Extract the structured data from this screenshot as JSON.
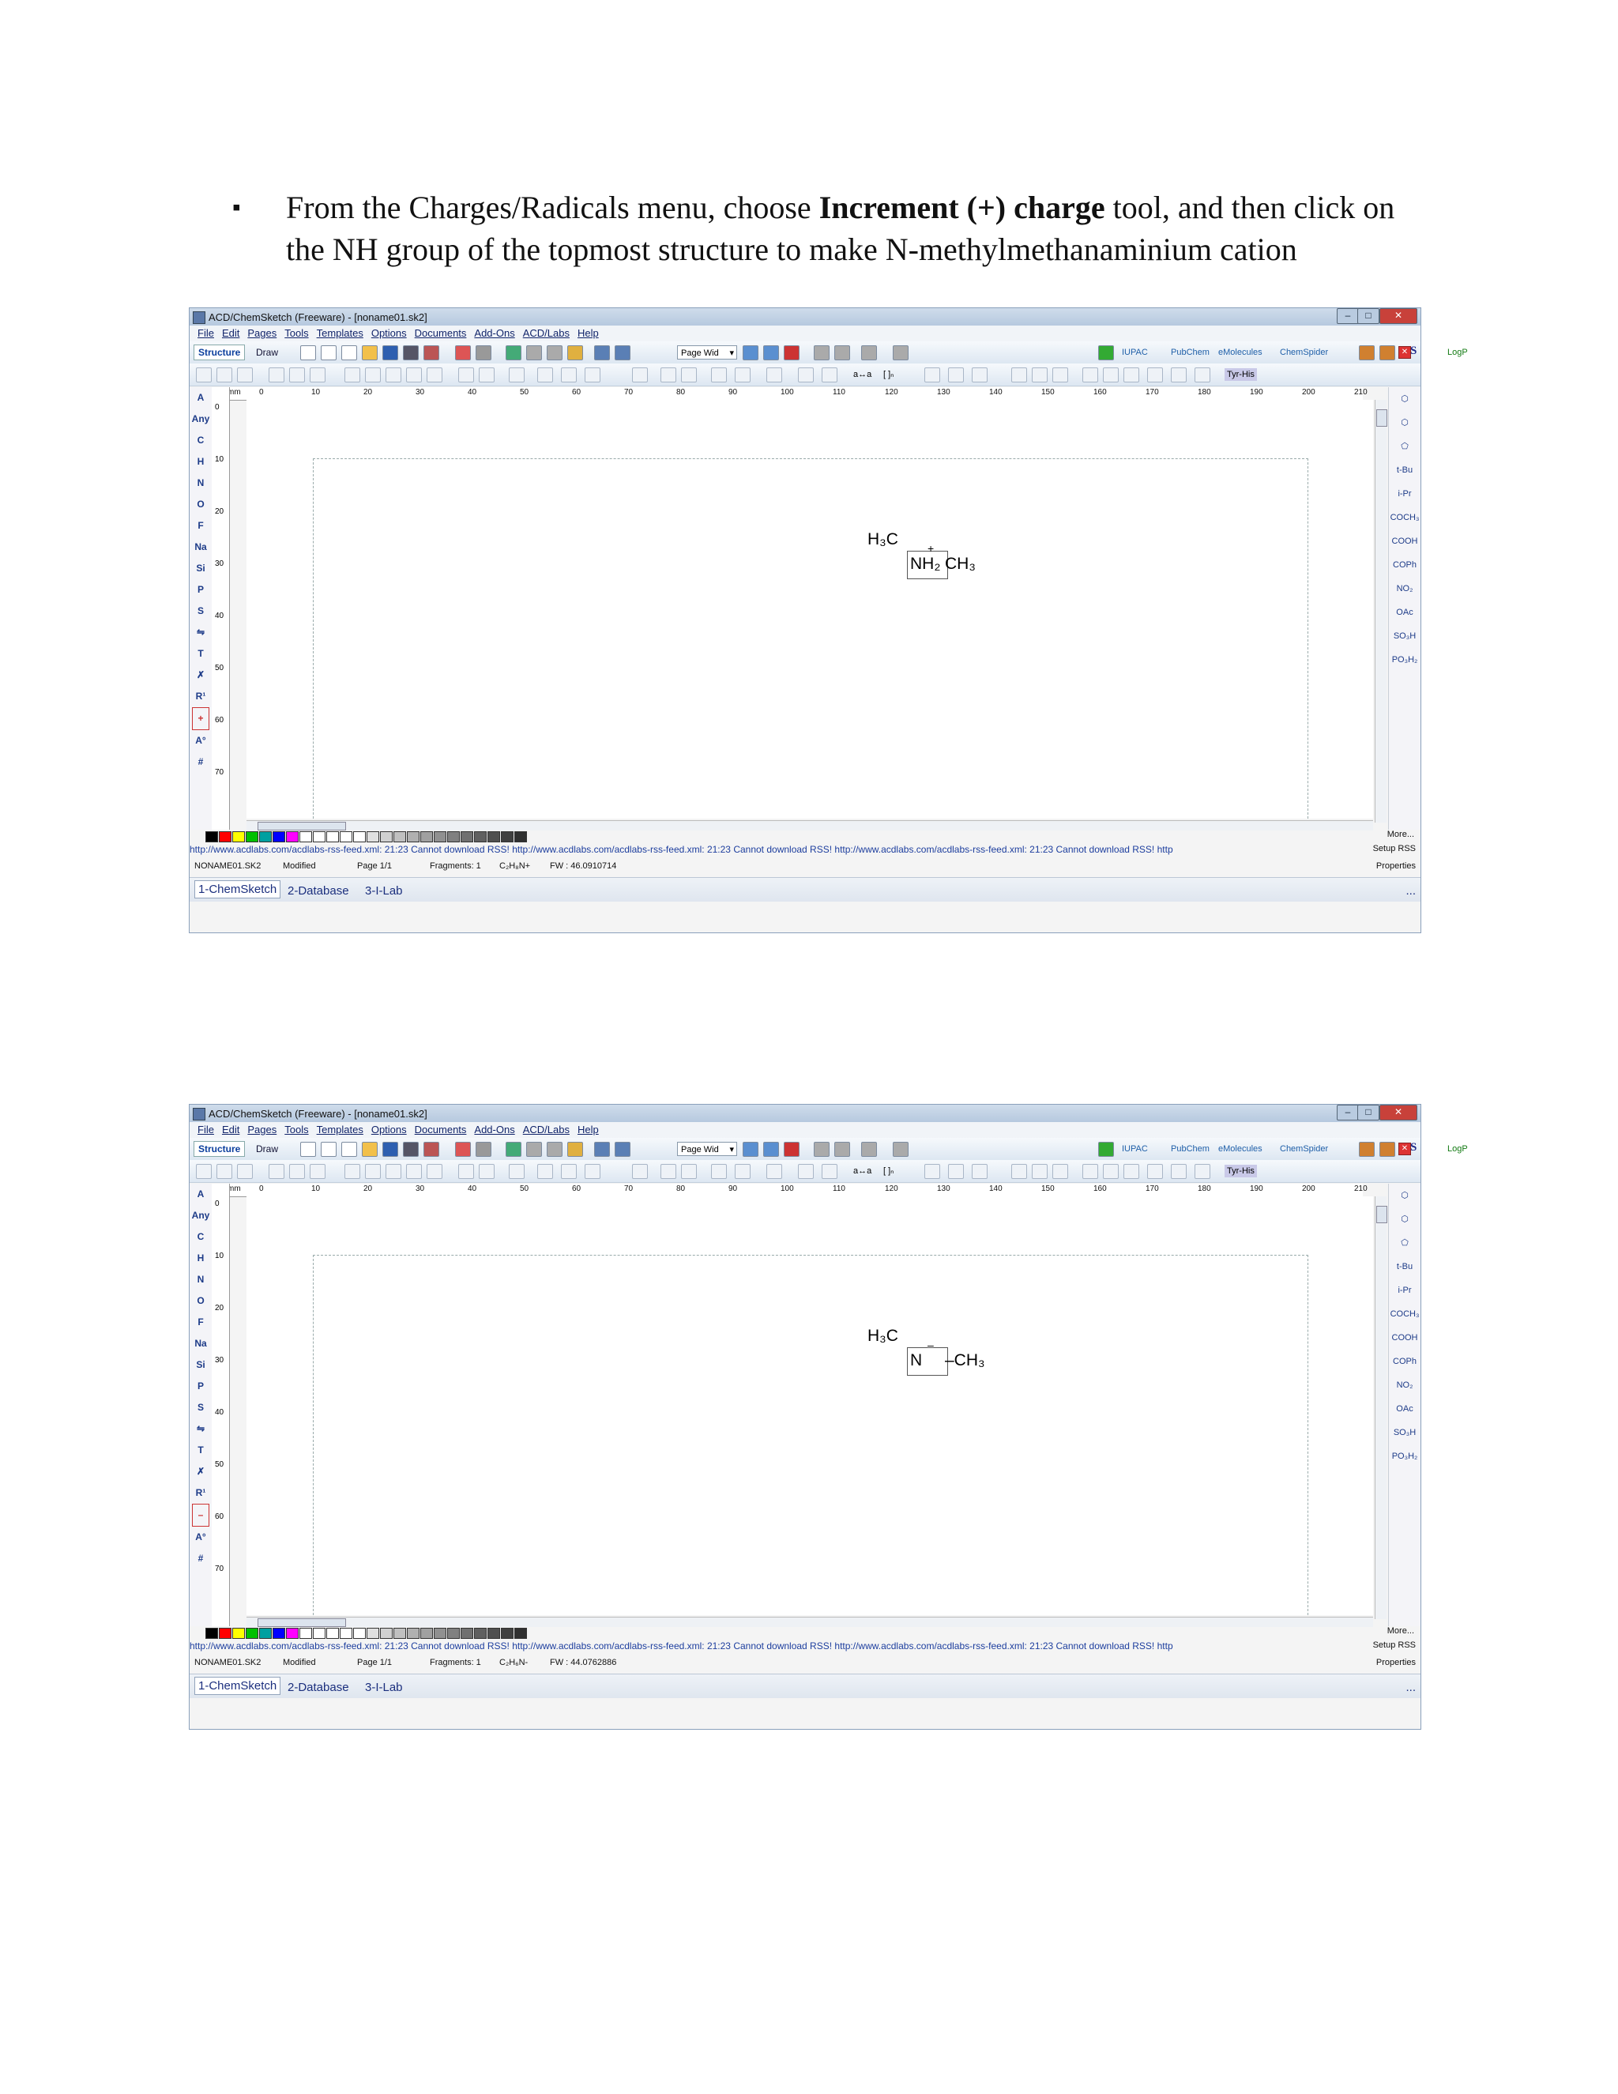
{
  "instruction": {
    "bullet": "▪",
    "prefix": "From the Charges/Radicals menu, choose ",
    "bold": "Increment (+) charge",
    "suffix": " tool, and then click on the NH group of the topmost structure to make N-methylmethanaminium cation"
  },
  "windows": [
    {
      "title": "ACD/ChemSketch (Freeware) - [noname01.sk2]",
      "menu": [
        "File",
        "Edit",
        "Pages",
        "Tools",
        "Templates",
        "Options",
        "Documents",
        "Add-Ons",
        "ACD/Labs",
        "Help"
      ],
      "mode_structure": "Structure",
      "mode_draw": "Draw",
      "zoom": "Page Wid",
      "ruler_unit": "mm",
      "h_ticks": [
        "0",
        "10",
        "20",
        "30",
        "40",
        "50",
        "60",
        "70",
        "80",
        "90",
        "100",
        "110",
        "120",
        "130",
        "140",
        "150",
        "160",
        "170",
        "180",
        "190",
        "200",
        "210"
      ],
      "v_ticks": [
        "0",
        "10",
        "20",
        "30",
        "40",
        "50",
        "60",
        "70"
      ],
      "left_palette": [
        "A",
        "Any",
        "C",
        "H",
        "N",
        "O",
        "F",
        "Na",
        "Si",
        "P",
        "S",
        "⇋",
        "T",
        "✗",
        "R¹",
        "+",
        "A°",
        "#"
      ],
      "right_palette": [
        "⬡",
        "⬡",
        "⬠",
        "t-Bu",
        "i-Pr",
        "COCH₃",
        "COOH",
        "COPh",
        "NO₂",
        "OAc",
        "SO₃H",
        "PO₃H₂"
      ],
      "molecule_top": "H₃C",
      "molecule_center": "NH₂",
      "molecule_charge": "+",
      "molecule_right": "CH₃",
      "more": "More...",
      "rss": "http://www.acdlabs.com/acdlabs-rss-feed.xml: 21:23 Cannot download RSS! http://www.acdlabs.com/acdlabs-rss-feed.xml: 21:23 Cannot download RSS! http://www.acdlabs.com/acdlabs-rss-feed.xml: 21:23 Cannot download RSS! http",
      "setup_rss": "Setup RSS",
      "status_file": "NONAME01.SK2",
      "status_modified": "Modified",
      "status_page": "Page 1/1",
      "status_fragments": "Fragments: 1",
      "status_formula": "C₂H₈N+",
      "status_fw": "FW : 46.0910714",
      "properties": "Properties",
      "tabs": [
        "1-ChemSketch",
        "2-Database",
        "3-I-Lab"
      ],
      "dots": "..."
    },
    {
      "title": "ACD/ChemSketch (Freeware) - [noname01.sk2]",
      "menu": [
        "File",
        "Edit",
        "Pages",
        "Tools",
        "Templates",
        "Options",
        "Documents",
        "Add-Ons",
        "ACD/Labs",
        "Help"
      ],
      "mode_structure": "Structure",
      "mode_draw": "Draw",
      "zoom": "Page Wid",
      "ruler_unit": "mm",
      "h_ticks": [
        "0",
        "10",
        "20",
        "30",
        "40",
        "50",
        "60",
        "70",
        "80",
        "90",
        "100",
        "110",
        "120",
        "130",
        "140",
        "150",
        "160",
        "170",
        "180",
        "190",
        "200",
        "210"
      ],
      "v_ticks": [
        "0",
        "10",
        "20",
        "30",
        "40",
        "50",
        "60",
        "70"
      ],
      "left_palette": [
        "A",
        "Any",
        "C",
        "H",
        "N",
        "O",
        "F",
        "Na",
        "Si",
        "P",
        "S",
        "⇋",
        "T",
        "✗",
        "R¹",
        "–",
        "A°",
        "#"
      ],
      "right_palette": [
        "⬡",
        "⬡",
        "⬠",
        "t-Bu",
        "i-Pr",
        "COCH₃",
        "COOH",
        "COPh",
        "NO₂",
        "OAc",
        "SO₃H",
        "PO₃H₂"
      ],
      "molecule_top": "H₃C",
      "molecule_center": "N",
      "molecule_charge": "–",
      "molecule_right": "–CH₃",
      "more": "More...",
      "rss": "http://www.acdlabs.com/acdlabs-rss-feed.xml: 21:23 Cannot download RSS! http://www.acdlabs.com/acdlabs-rss-feed.xml: 21:23 Cannot download RSS! http://www.acdlabs.com/acdlabs-rss-feed.xml: 21:23 Cannot download RSS! http",
      "setup_rss": "Setup RSS",
      "status_file": "NONAME01.SK2",
      "status_modified": "Modified",
      "status_page": "Page 1/1",
      "status_fragments": "Fragments: 1",
      "status_formula": "C₂H₆N-",
      "status_fw": "FW : 44.0762886",
      "properties": "Properties",
      "tabs": [
        "1-ChemSketch",
        "2-Database",
        "3-I-Lab"
      ],
      "dots": "..."
    }
  ],
  "toolbar": {
    "tb_labels": {
      "iupac": "IUPAC",
      "pubchem": "PubChem",
      "emolecules": "eMolecules",
      "chemspider": "ChemSpider",
      "rs": "R/S",
      "logp": "LogP",
      "tyrhis": "Tyr-His",
      "ab": "a↔a",
      "bracket": "[ ]ₙ"
    }
  },
  "colors": {
    "accent": "#1b3f9c",
    "titlebar": "#c5d5e8",
    "close": "#c8413a"
  },
  "palette_colors": [
    "#000000",
    "#ff0000",
    "#ffff00",
    "#00c000",
    "#00a0a0",
    "#0000ff",
    "#ff00ff",
    "#ffffff",
    "#ffffff",
    "#ffffff",
    "#ffffff",
    "#ffffff",
    "#e0e0e0",
    "#d0d0d0",
    "#c0c0c0",
    "#b0b0b0",
    "#a0a0a0",
    "#909090",
    "#808080",
    "#707070",
    "#606060",
    "#505050",
    "#404040",
    "#303030"
  ]
}
